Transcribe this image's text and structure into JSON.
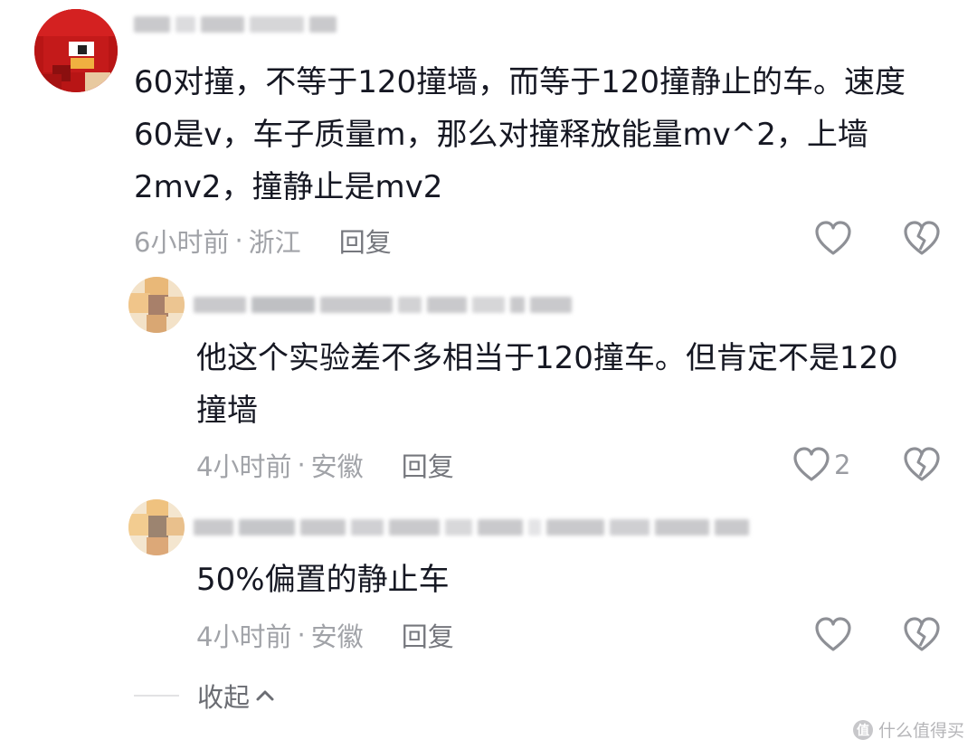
{
  "comments": [
    {
      "lines": [
        "60对撞，不等于120撞墙，而等于120撞静止的车。速度",
        "60是v，车子质量m，那么对撞释放能量mv^2，上墙",
        "2mv2，撞静止是mv2"
      ],
      "time": "6小时前",
      "location": "浙江",
      "reply_label": "回复"
    },
    {
      "lines": [
        "他这个实验差不多相当于120撞车。但肯定不是120",
        "撞墙"
      ],
      "time": "4小时前",
      "location": "安徽",
      "reply_label": "回复",
      "like_count": "2"
    },
    {
      "lines": [
        "50%偏置的静止车"
      ],
      "time": "4小时前",
      "location": "安徽",
      "reply_label": "回复"
    }
  ],
  "meta_separator": "·",
  "collapse_label": "收起",
  "watermark": {
    "glyph": "值",
    "text": "什么值得买"
  },
  "icons": {
    "like": "heart-outline-icon",
    "dislike": "broken-heart-icon",
    "collapse": "chevron-up-icon"
  },
  "colors": {
    "text": "#161823",
    "meta": "#a1a3a8",
    "reply": "#75777d",
    "avatar_main": "#d01c1c"
  }
}
